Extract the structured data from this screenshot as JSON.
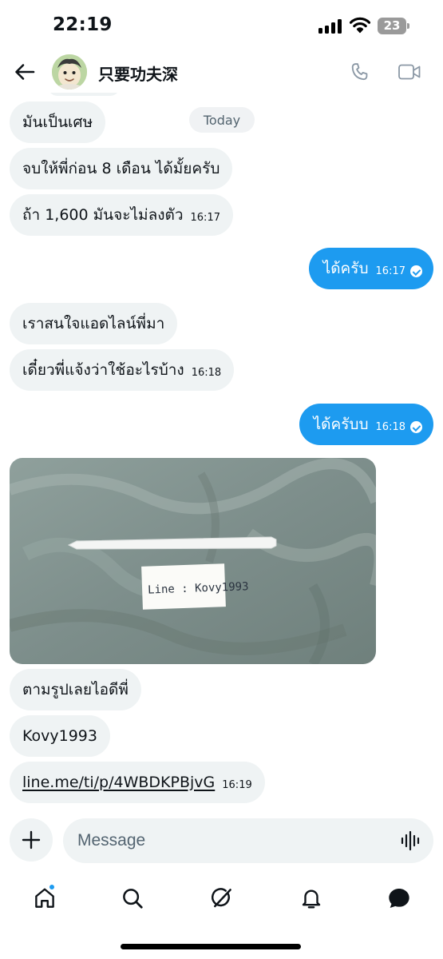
{
  "status_bar": {
    "time": "22:19",
    "battery_level": "23",
    "icons": [
      "cellular-signal-icon",
      "wifi-icon",
      "battery-icon"
    ]
  },
  "header": {
    "contact_name": "只要功夫深",
    "icons": [
      "back-arrow-icon",
      "phone-icon",
      "video-camera-icon"
    ]
  },
  "conversation": {
    "day_label": "Today",
    "messages": [
      {
        "direction": "in",
        "text": "มันเป็นเศษ",
        "time": ""
      },
      {
        "direction": "in",
        "text": "จบให้พี่ก่อน 8 เดือน ได้มั้ยครับ",
        "time": ""
      },
      {
        "direction": "in",
        "text": "ถ้า 1,600 มันจะไม่ลงตัว",
        "time": "16:17"
      },
      {
        "direction": "out",
        "text": "ได้ครับ",
        "time": "16:17",
        "status": "read"
      },
      {
        "direction": "in",
        "text": "เราสนใจแอดไลน์พี่มา",
        "time": ""
      },
      {
        "direction": "in",
        "text": "เดี๋ยวพี่แจ้งว่าใช้อะไรบ้าง",
        "time": "16:18"
      },
      {
        "direction": "out",
        "text": "ได้ครับบ",
        "time": "16:18",
        "status": "read"
      },
      {
        "direction": "in",
        "type": "photo",
        "photo_note": "Line : Kovy1993"
      },
      {
        "direction": "in",
        "text": "ตามรูปเลยไอดีพี่",
        "time": ""
      },
      {
        "direction": "in",
        "text": "Kovy1993",
        "time": ""
      },
      {
        "direction": "in",
        "type": "link",
        "text": "line.me/ti/p/4WBDKPBjvG",
        "time": "16:19"
      }
    ]
  },
  "composer": {
    "placeholder": "Message",
    "icons": [
      "plus-icon",
      "voice-wave-icon"
    ]
  },
  "tab_bar": {
    "tabs": [
      "home",
      "search",
      "grok",
      "notifications",
      "messages"
    ],
    "active_tab": "messages",
    "home_has_unread_dot": true
  },
  "colors": {
    "accent": "#1d9bf0",
    "incoming_bubble": "#eff3f4",
    "text_primary": "#0f1419",
    "text_secondary": "#536471"
  }
}
